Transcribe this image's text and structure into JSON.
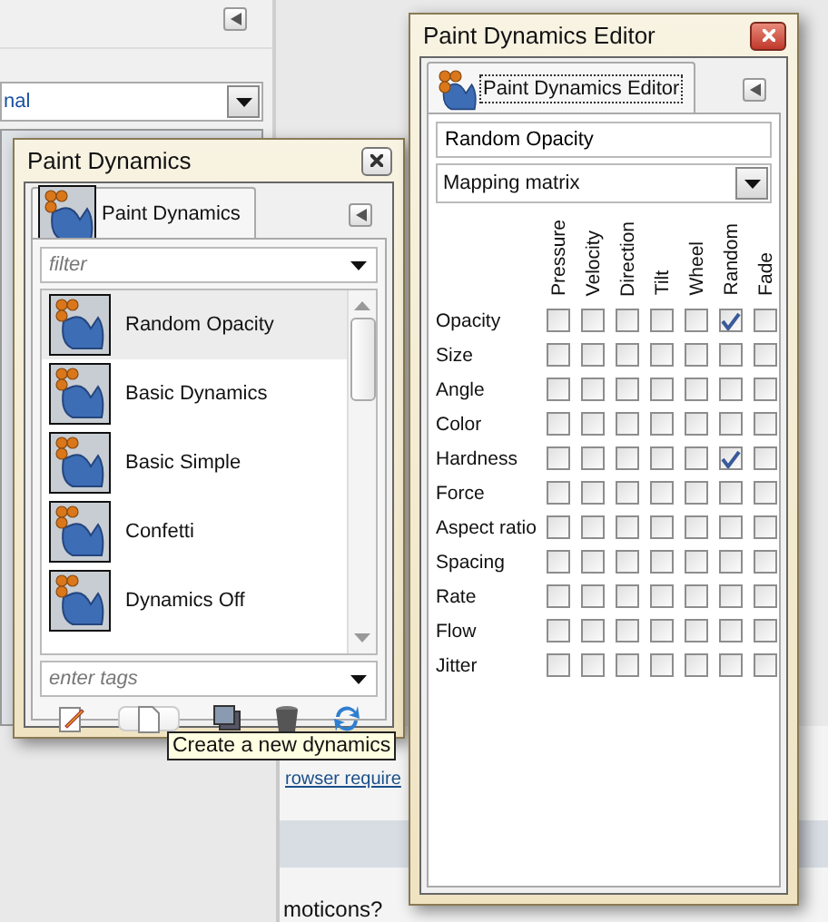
{
  "background_window": {
    "dropdown_value": "nal"
  },
  "page_behind": {
    "link": "rowser require",
    "text": "moticons?"
  },
  "dynamics_dialog": {
    "title": "Paint Dynamics",
    "tab": {
      "label": "Paint Dynamics",
      "selected": true
    },
    "filter_placeholder": "filter",
    "items": [
      {
        "name": "Random Opacity",
        "selected": true
      },
      {
        "name": "Basic Dynamics",
        "selected": false
      },
      {
        "name": "Basic Simple",
        "selected": false
      },
      {
        "name": "Confetti",
        "selected": false
      },
      {
        "name": "Dynamics Off",
        "selected": false
      }
    ],
    "tags_placeholder": "enter tags",
    "tooltip": "Create a new dynamics"
  },
  "editor": {
    "title": "Paint Dynamics Editor",
    "tab": {
      "label": "Paint Dynamics Editor",
      "selected": true
    },
    "name_value": "Random Opacity",
    "mode": "Mapping matrix",
    "columns": [
      "Pressure",
      "Velocity",
      "Direction",
      "Tilt",
      "Wheel",
      "Random",
      "Fade"
    ],
    "rows": [
      {
        "label": "Opacity",
        "checks": [
          false,
          false,
          false,
          false,
          false,
          true,
          false
        ]
      },
      {
        "label": "Size",
        "checks": [
          false,
          false,
          false,
          false,
          false,
          false,
          false
        ]
      },
      {
        "label": "Angle",
        "checks": [
          false,
          false,
          false,
          false,
          false,
          false,
          false
        ]
      },
      {
        "label": "Color",
        "checks": [
          false,
          false,
          false,
          false,
          false,
          false,
          false
        ]
      },
      {
        "label": "Hardness",
        "checks": [
          false,
          false,
          false,
          false,
          false,
          true,
          false
        ]
      },
      {
        "label": "Force",
        "checks": [
          false,
          false,
          false,
          false,
          false,
          false,
          false
        ]
      },
      {
        "label": "Aspect ratio",
        "checks": [
          false,
          false,
          false,
          false,
          false,
          false,
          false
        ]
      },
      {
        "label": "Spacing",
        "checks": [
          false,
          false,
          false,
          false,
          false,
          false,
          false
        ]
      },
      {
        "label": "Rate",
        "checks": [
          false,
          false,
          false,
          false,
          false,
          false,
          false
        ]
      },
      {
        "label": "Flow",
        "checks": [
          false,
          false,
          false,
          false,
          false,
          false,
          false
        ]
      },
      {
        "label": "Jitter",
        "checks": [
          false,
          false,
          false,
          false,
          false,
          false,
          false
        ]
      }
    ]
  }
}
